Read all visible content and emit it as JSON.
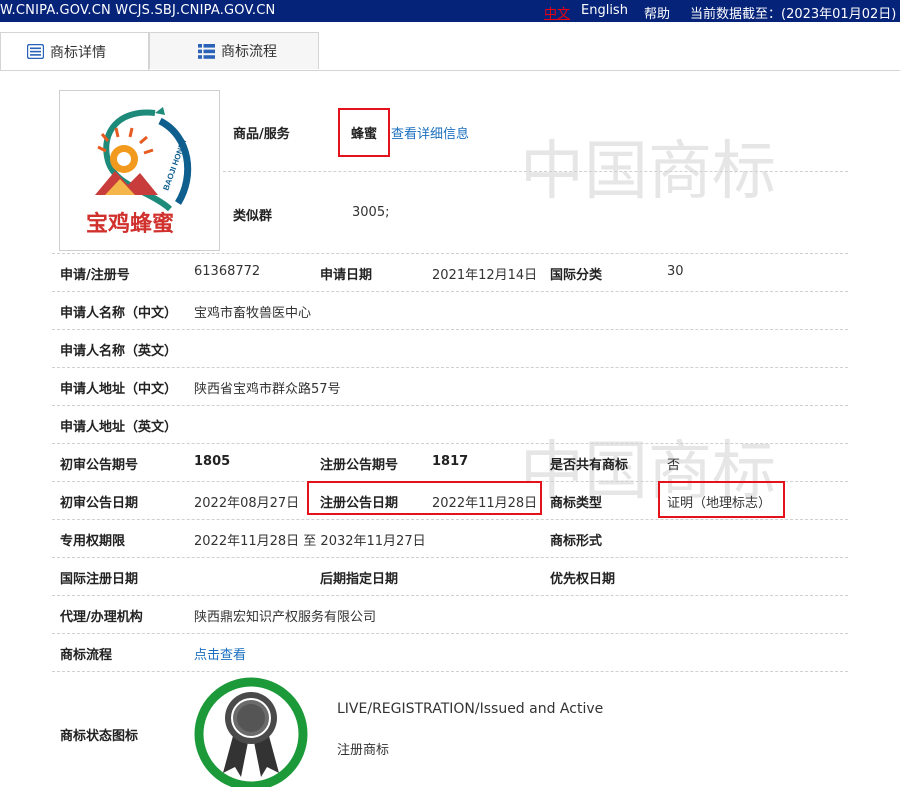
{
  "topbar": {
    "url": "W.CNIPA.GOV.CN WCJS.SBJ.CNIPA.GOV.CN",
    "lang_cn": "中文",
    "lang_en": "English",
    "help": "帮助",
    "date_label": "当前数据截至：(2023年01月02日)"
  },
  "tabs": [
    {
      "label": "商标详情",
      "icon": "list-icon"
    },
    {
      "label": "商标流程",
      "icon": "grid-icon"
    }
  ],
  "goods": {
    "label": "商品/服务",
    "value": "蜂蜜",
    "detail_link": "查看详细信息"
  },
  "similar_group": {
    "label": "类似群",
    "value": "3005;"
  },
  "rows": {
    "reg_no_label": "申请/注册号",
    "reg_no": "61368772",
    "apply_date_label": "申请日期",
    "apply_date": "2021年12月14日",
    "intl_class_label": "国际分类",
    "intl_class": "30",
    "applicant_cn_label": "申请人名称（中文）",
    "applicant_cn": "宝鸡市畜牧兽医中心",
    "applicant_en_label": "申请人名称（英文）",
    "applicant_en": "",
    "address_cn_label": "申请人地址（中文）",
    "address_cn": "陕西省宝鸡市群众路57号",
    "address_en_label": "申请人地址（英文）",
    "address_en": "",
    "prelim_no_label": "初审公告期号",
    "prelim_no": "1805",
    "reg_pub_no_label": "注册公告期号",
    "reg_pub_no": "1817",
    "shared_label": "是否共有商标",
    "shared": "否",
    "prelim_date_label": "初审公告日期",
    "prelim_date": "2022年08月27日",
    "reg_pub_date_label": "注册公告日期",
    "reg_pub_date": "2022年11月28日",
    "type_label": "商标类型",
    "type": "证明（地理标志）",
    "exclusive_label": "专用权期限",
    "exclusive": "2022年11月28日 至 2032年11月27日",
    "form_label": "商标形式",
    "form": "",
    "intl_reg_date_label": "国际注册日期",
    "later_date_label": "后期指定日期",
    "priority_label": "优先权日期",
    "agent_label": "代理/办理机构",
    "agent": "陕西鼎宏知识产权服务有限公司",
    "flow_label": "商标流程",
    "flow_link": "点击查看",
    "status_label": "商标状态图标",
    "status_en": "LIVE/REGISTRATION/Issued and Active",
    "status_cn": "注册商标"
  },
  "logo": {
    "text_cn": "宝鸡蜂蜜",
    "text_en": "BAOJI HONEY"
  },
  "watermark": {
    "text": "中国商标"
  },
  "colors": {
    "topbar_bg": "#06237a",
    "highlight": "#e4121a",
    "link": "#1a6fbf",
    "badge_ring": "#1c9a3a"
  }
}
